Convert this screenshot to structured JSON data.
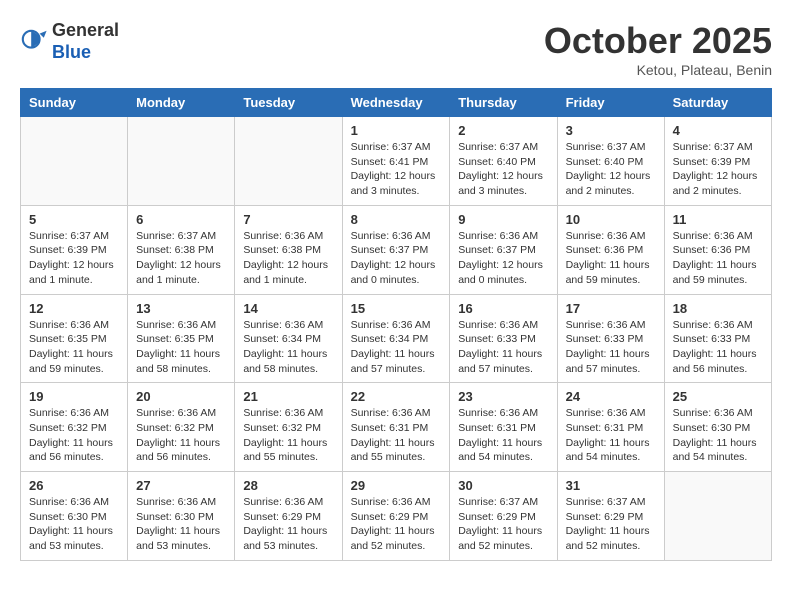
{
  "header": {
    "logo_general": "General",
    "logo_blue": "Blue",
    "month_title": "October 2025",
    "location": "Ketou, Plateau, Benin"
  },
  "weekdays": [
    "Sunday",
    "Monday",
    "Tuesday",
    "Wednesday",
    "Thursday",
    "Friday",
    "Saturday"
  ],
  "weeks": [
    [
      {
        "day": "",
        "info": ""
      },
      {
        "day": "",
        "info": ""
      },
      {
        "day": "",
        "info": ""
      },
      {
        "day": "1",
        "info": "Sunrise: 6:37 AM\nSunset: 6:41 PM\nDaylight: 12 hours\nand 3 minutes."
      },
      {
        "day": "2",
        "info": "Sunrise: 6:37 AM\nSunset: 6:40 PM\nDaylight: 12 hours\nand 3 minutes."
      },
      {
        "day": "3",
        "info": "Sunrise: 6:37 AM\nSunset: 6:40 PM\nDaylight: 12 hours\nand 2 minutes."
      },
      {
        "day": "4",
        "info": "Sunrise: 6:37 AM\nSunset: 6:39 PM\nDaylight: 12 hours\nand 2 minutes."
      }
    ],
    [
      {
        "day": "5",
        "info": "Sunrise: 6:37 AM\nSunset: 6:39 PM\nDaylight: 12 hours\nand 1 minute."
      },
      {
        "day": "6",
        "info": "Sunrise: 6:37 AM\nSunset: 6:38 PM\nDaylight: 12 hours\nand 1 minute."
      },
      {
        "day": "7",
        "info": "Sunrise: 6:36 AM\nSunset: 6:38 PM\nDaylight: 12 hours\nand 1 minute."
      },
      {
        "day": "8",
        "info": "Sunrise: 6:36 AM\nSunset: 6:37 PM\nDaylight: 12 hours\nand 0 minutes."
      },
      {
        "day": "9",
        "info": "Sunrise: 6:36 AM\nSunset: 6:37 PM\nDaylight: 12 hours\nand 0 minutes."
      },
      {
        "day": "10",
        "info": "Sunrise: 6:36 AM\nSunset: 6:36 PM\nDaylight: 11 hours\nand 59 minutes."
      },
      {
        "day": "11",
        "info": "Sunrise: 6:36 AM\nSunset: 6:36 PM\nDaylight: 11 hours\nand 59 minutes."
      }
    ],
    [
      {
        "day": "12",
        "info": "Sunrise: 6:36 AM\nSunset: 6:35 PM\nDaylight: 11 hours\nand 59 minutes."
      },
      {
        "day": "13",
        "info": "Sunrise: 6:36 AM\nSunset: 6:35 PM\nDaylight: 11 hours\nand 58 minutes."
      },
      {
        "day": "14",
        "info": "Sunrise: 6:36 AM\nSunset: 6:34 PM\nDaylight: 11 hours\nand 58 minutes."
      },
      {
        "day": "15",
        "info": "Sunrise: 6:36 AM\nSunset: 6:34 PM\nDaylight: 11 hours\nand 57 minutes."
      },
      {
        "day": "16",
        "info": "Sunrise: 6:36 AM\nSunset: 6:33 PM\nDaylight: 11 hours\nand 57 minutes."
      },
      {
        "day": "17",
        "info": "Sunrise: 6:36 AM\nSunset: 6:33 PM\nDaylight: 11 hours\nand 57 minutes."
      },
      {
        "day": "18",
        "info": "Sunrise: 6:36 AM\nSunset: 6:33 PM\nDaylight: 11 hours\nand 56 minutes."
      }
    ],
    [
      {
        "day": "19",
        "info": "Sunrise: 6:36 AM\nSunset: 6:32 PM\nDaylight: 11 hours\nand 56 minutes."
      },
      {
        "day": "20",
        "info": "Sunrise: 6:36 AM\nSunset: 6:32 PM\nDaylight: 11 hours\nand 56 minutes."
      },
      {
        "day": "21",
        "info": "Sunrise: 6:36 AM\nSunset: 6:32 PM\nDaylight: 11 hours\nand 55 minutes."
      },
      {
        "day": "22",
        "info": "Sunrise: 6:36 AM\nSunset: 6:31 PM\nDaylight: 11 hours\nand 55 minutes."
      },
      {
        "day": "23",
        "info": "Sunrise: 6:36 AM\nSunset: 6:31 PM\nDaylight: 11 hours\nand 54 minutes."
      },
      {
        "day": "24",
        "info": "Sunrise: 6:36 AM\nSunset: 6:31 PM\nDaylight: 11 hours\nand 54 minutes."
      },
      {
        "day": "25",
        "info": "Sunrise: 6:36 AM\nSunset: 6:30 PM\nDaylight: 11 hours\nand 54 minutes."
      }
    ],
    [
      {
        "day": "26",
        "info": "Sunrise: 6:36 AM\nSunset: 6:30 PM\nDaylight: 11 hours\nand 53 minutes."
      },
      {
        "day": "27",
        "info": "Sunrise: 6:36 AM\nSunset: 6:30 PM\nDaylight: 11 hours\nand 53 minutes."
      },
      {
        "day": "28",
        "info": "Sunrise: 6:36 AM\nSunset: 6:29 PM\nDaylight: 11 hours\nand 53 minutes."
      },
      {
        "day": "29",
        "info": "Sunrise: 6:36 AM\nSunset: 6:29 PM\nDaylight: 11 hours\nand 52 minutes."
      },
      {
        "day": "30",
        "info": "Sunrise: 6:37 AM\nSunset: 6:29 PM\nDaylight: 11 hours\nand 52 minutes."
      },
      {
        "day": "31",
        "info": "Sunrise: 6:37 AM\nSunset: 6:29 PM\nDaylight: 11 hours\nand 52 minutes."
      },
      {
        "day": "",
        "info": ""
      }
    ]
  ]
}
